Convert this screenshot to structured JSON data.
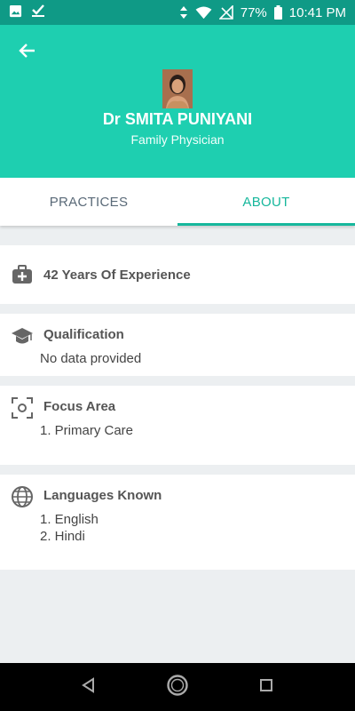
{
  "status_bar": {
    "battery": "77%",
    "time": "10:41 PM",
    "icons": [
      "image-icon",
      "checkbox-icon",
      "data-arrows-icon",
      "wifi-icon",
      "no-signal-icon",
      "battery-icon"
    ]
  },
  "header": {
    "back_icon": "arrow-back-icon",
    "doctor_name": "Dr SMITA PUNIYANI",
    "doctor_role": "Family Physician"
  },
  "tabs": [
    {
      "label": "PRACTICES",
      "active": false
    },
    {
      "label": "ABOUT",
      "active": true
    }
  ],
  "colors": {
    "header_bg": "#1ecfb0",
    "status_bg": "#0f9a86",
    "accent": "#16b79c"
  },
  "about": {
    "experience": {
      "icon": "medical-bag-icon",
      "text": "42 Years Of Experience"
    },
    "qualification": {
      "icon": "graduation-cap-icon",
      "title": "Qualification",
      "items": [
        "No data provided"
      ]
    },
    "focus_area": {
      "icon": "focus-center-icon",
      "title": "Focus Area",
      "items": [
        "1. Primary Care"
      ]
    },
    "languages": {
      "icon": "globe-icon",
      "title": "Languages Known",
      "items": [
        "1. English",
        "2. Hindi"
      ]
    }
  },
  "nav_bar": {
    "icons": [
      "back-triangle-icon",
      "home-circle-icon",
      "recents-square-icon"
    ]
  }
}
